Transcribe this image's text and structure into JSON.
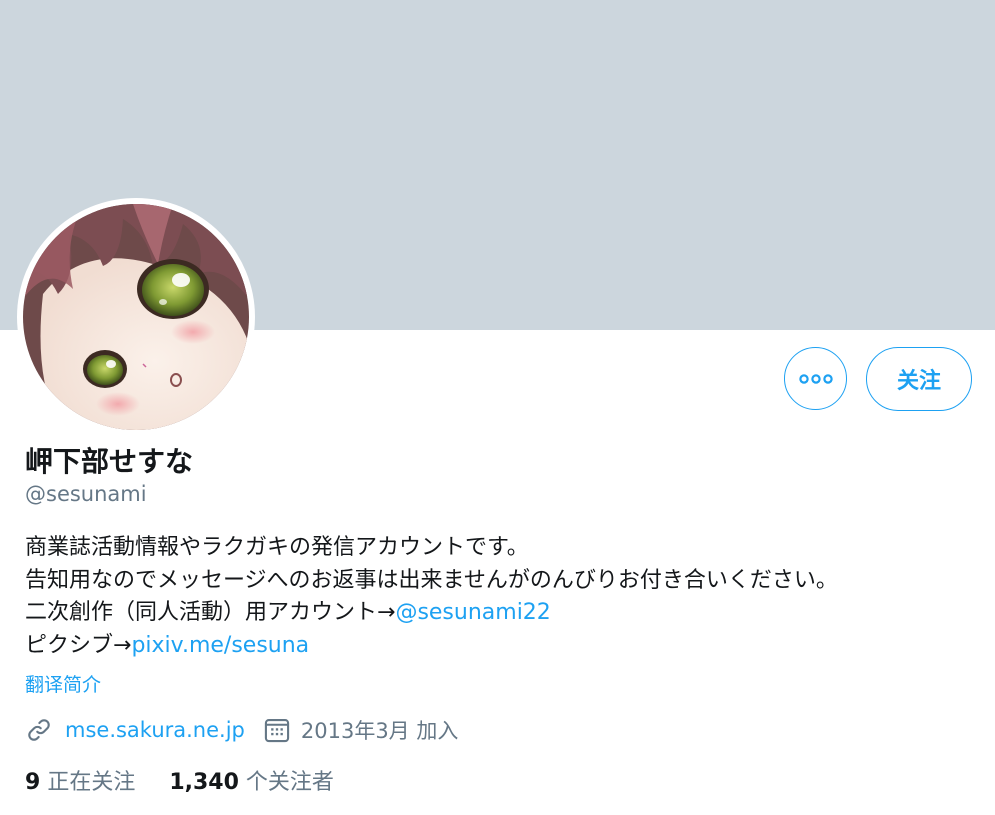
{
  "profile": {
    "name": "岬下部せすな",
    "handle": "@sesunami",
    "bio": {
      "line1": "商業誌活動情報やラクガキの発信アカウントです。",
      "line2": "告知用なのでメッセージへのお返事は出来ませんがのんびりお付き合いください。",
      "line3_prefix": "二次創作（同人活動）用アカウント→",
      "line3_link": "@sesunami22",
      "line4_prefix": "ピクシブ→",
      "line4_link": "pixiv.me/sesuna"
    },
    "translate_label": "翻译简介",
    "website": "mse.sakura.ne.jp",
    "joined": "2013年3月 加入"
  },
  "actions": {
    "more_icon": "more-icon",
    "follow_label": "关注"
  },
  "stats": {
    "following_count": "9",
    "following_label": "正在关注",
    "followers_count": "1,340",
    "followers_label": "个关注者"
  },
  "colors": {
    "banner": "#ccd6dd",
    "accent": "#1da1f2",
    "secondary_text": "#657786",
    "primary_text": "#14171a"
  },
  "icons": {
    "link": "link-icon",
    "calendar": "calendar-icon",
    "avatar": "avatar-image"
  }
}
